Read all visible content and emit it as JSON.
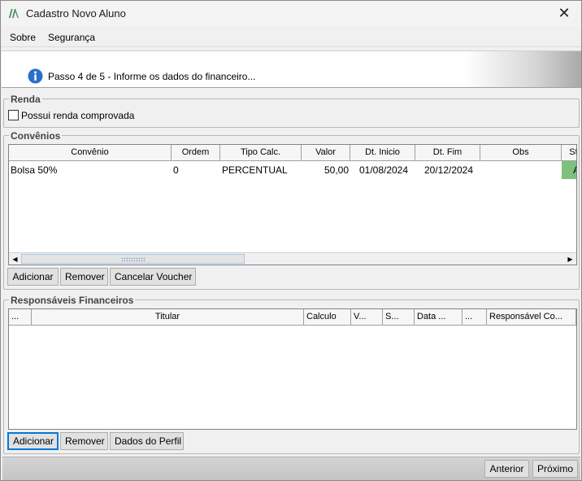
{
  "window": {
    "title": "Cadastro Novo Aluno",
    "close_glyph": "✕"
  },
  "menu": [
    {
      "label": "Sobre"
    },
    {
      "label": "Segurança"
    }
  ],
  "step": {
    "text": "Passo 4 de 5 - Informe os dados do financeiro..."
  },
  "renda": {
    "title": "Renda",
    "checkbox_label": "Possui renda comprovada",
    "checked": false
  },
  "convenios": {
    "title": "Convênios",
    "columns": [
      "Convênio",
      "Ordem",
      "Tipo Calc.",
      "Valor",
      "Dt. Inicio",
      "Dt. Fim",
      "Obs",
      "St"
    ],
    "rows": [
      {
        "convenio": "Bolsa 50%",
        "ordem": "0",
        "tipo_calc": "PERCENTUAL",
        "valor": "50,00",
        "dt_inicio": "01/08/2024",
        "dt_fim": "20/12/2024",
        "obs": "",
        "status": "A"
      }
    ],
    "buttons": {
      "add": "Adicionar",
      "remove": "Remover",
      "cancel_voucher": "Cancelar Voucher"
    }
  },
  "responsaveis": {
    "title": "Responsáveis Financeiros",
    "columns": [
      "...",
      "Titular",
      "Calculo",
      "V...",
      "S...",
      "Data ...",
      "...",
      "Responsável Co..."
    ],
    "rows": [],
    "buttons": {
      "add": "Adicionar",
      "remove": "Remover",
      "profile": "Dados do Perfil"
    }
  },
  "footer": {
    "prev": "Anterior",
    "next": "Próximo"
  },
  "icons": {
    "app": "app-logo-icon",
    "info": "info-icon",
    "close": "close-icon"
  },
  "colors": {
    "status_active": "#7fc07f",
    "info_blue": "#2a6fc9",
    "focus": "#0078d7"
  }
}
